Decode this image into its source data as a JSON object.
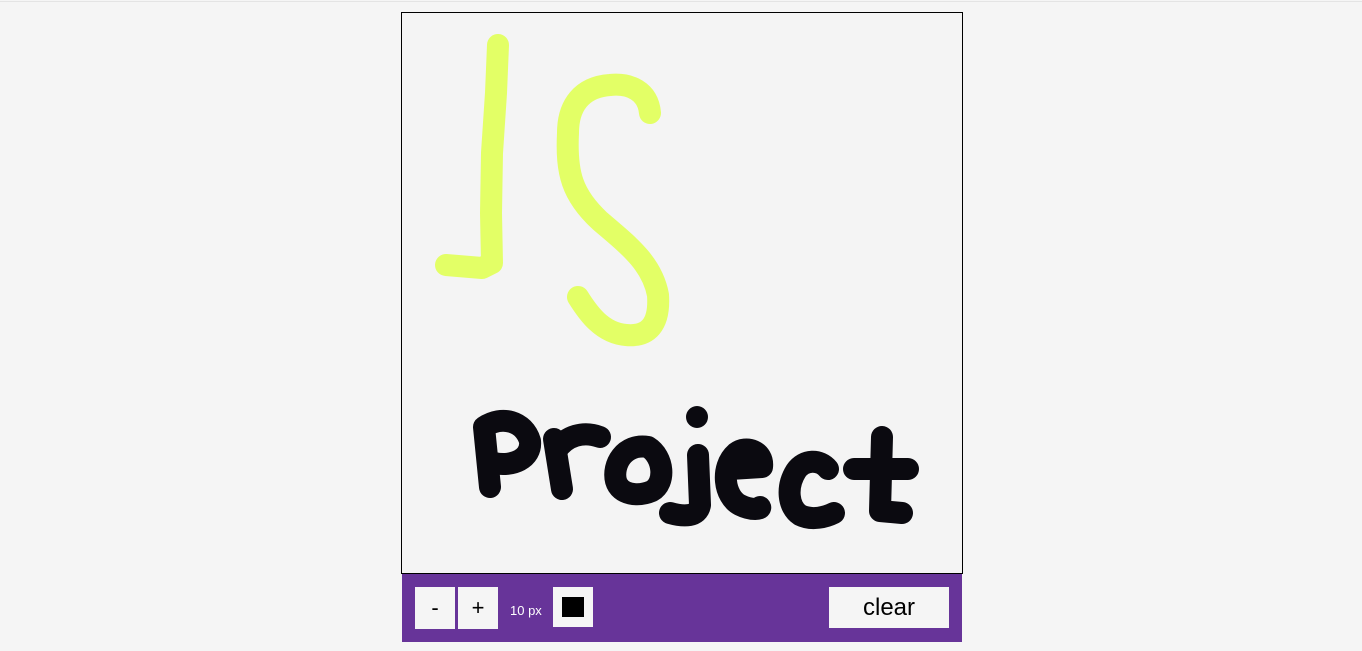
{
  "toolbar": {
    "decrease_label": "-",
    "increase_label": "+",
    "size_label": "10 px",
    "clear_label": "clear",
    "current_color": "#000000",
    "background_color": "#673499"
  },
  "canvas": {
    "background_color": "#f4f4f4",
    "stroke_colors": [
      "#e3ff66",
      "#0b0a10"
    ]
  }
}
